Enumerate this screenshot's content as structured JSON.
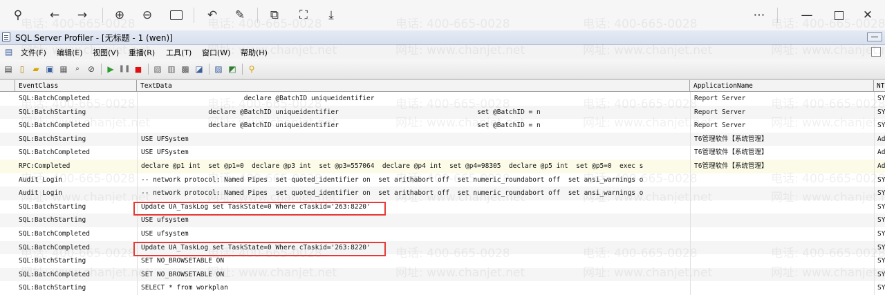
{
  "window": {
    "title": "SQL Server Profiler - [无标题 - 1 (wen)]"
  },
  "menu": {
    "items": [
      "文件(F)",
      "编辑(E)",
      "视图(V)",
      "重播(R)",
      "工具(T)",
      "窗口(W)",
      "帮助(H)"
    ]
  },
  "grid": {
    "columns": [
      "EventClass",
      "TextData",
      "ApplicationName",
      "NT"
    ],
    "rows": [
      {
        "event": "SQL:BatchCompleted",
        "text": "                          declare @BatchID uniqueidentifier",
        "app": "Report Server",
        "nt": "SY"
      },
      {
        "event": "SQL:BatchStarting",
        "text": "                 declare @BatchID uniqueidentifier                                   set @BatchID = n",
        "app": "Report Server",
        "nt": "SY"
      },
      {
        "event": "SQL:BatchCompleted",
        "text": "                 declare @BatchID uniqueidentifier                                   set @BatchID = n",
        "app": "Report Server",
        "nt": "SY"
      },
      {
        "event": "SQL:BatchStarting",
        "text": "USE UFSystem",
        "app": "T6管理软件【系统管理】",
        "nt": "Ad"
      },
      {
        "event": "SQL:BatchCompleted",
        "text": "USE UFSystem",
        "app": "T6管理软件【系统管理】",
        "nt": "Ad"
      },
      {
        "event": "RPC:Completed",
        "text": "declare @p1 int  set @p1=0  declare @p3 int  set @p3=557064  declare @p4 int  set @p4=98305  declare @p5 int  set @p5=0  exec s",
        "app": "T6管理软件【系统管理】",
        "nt": "Ad"
      },
      {
        "event": "Audit Login",
        "text": "-- network protocol: Named Pipes  set quoted_identifier on  set arithabort off  set numeric_roundabort off  set ansi_warnings o",
        "app": "",
        "nt": "SY"
      },
      {
        "event": "Audit Login",
        "text": "-- network protocol: Named Pipes  set quoted_identifier on  set arithabort off  set numeric_roundabort off  set ansi_warnings o",
        "app": "",
        "nt": "SY"
      },
      {
        "event": "SQL:BatchStarting",
        "text": "Update UA_TaskLog set TaskState=0 Where cTaskid='263:8220'",
        "app": "",
        "nt": "SY"
      },
      {
        "event": "SQL:BatchStarting",
        "text": "USE ufsystem",
        "app": "",
        "nt": "SY"
      },
      {
        "event": "SQL:BatchCompleted",
        "text": "USE ufsystem",
        "app": "",
        "nt": "SY"
      },
      {
        "event": "SQL:BatchCompleted",
        "text": "Update UA_TaskLog set TaskState=0 Where cTaskid='263:8220'",
        "app": "",
        "nt": "SY"
      },
      {
        "event": "SQL:BatchStarting",
        "text": "SET NO_BROWSETABLE ON",
        "app": "",
        "nt": "SY"
      },
      {
        "event": "SQL:BatchCompleted",
        "text": "SET NO_BROWSETABLE ON",
        "app": "",
        "nt": "SY"
      },
      {
        "event": "SQL:BatchStarting",
        "text": "SELECT * from workplan",
        "app": "",
        "nt": "SY"
      }
    ]
  },
  "watermark": {
    "phone": "电话: 400-665-0028",
    "site": "网址: www.chanjet.net"
  },
  "colors": {
    "highlight_box": "#e53935",
    "title_bar": "#d7dfee"
  }
}
